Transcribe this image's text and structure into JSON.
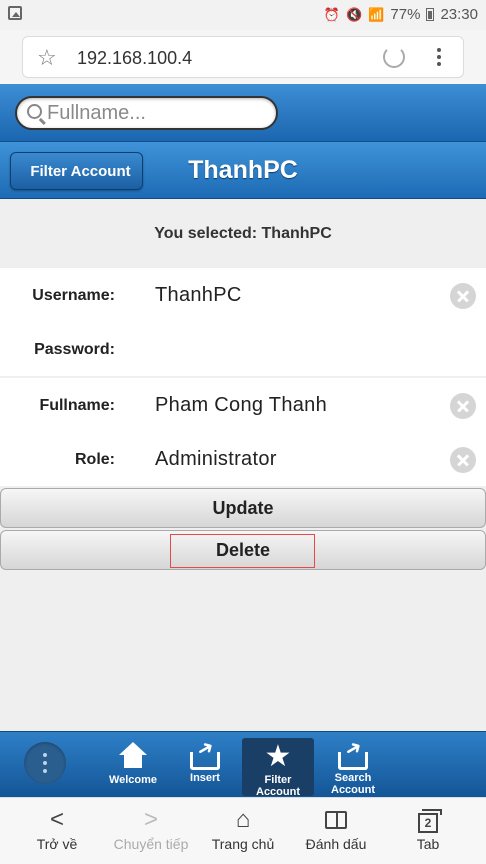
{
  "status_bar": {
    "battery": "77%",
    "time": "23:30"
  },
  "browser": {
    "url": "192.168.100.4"
  },
  "search": {
    "placeholder": "Fullname..."
  },
  "header": {
    "back_label": "Filter Account",
    "title": "ThanhPC"
  },
  "selection": {
    "text": "You selected: ThanhPC"
  },
  "form": {
    "username": {
      "label": "Username:",
      "value": "ThanhPC"
    },
    "password": {
      "label": "Password:",
      "value": ""
    },
    "fullname": {
      "label": "Fullname:",
      "value": "Pham Cong Thanh"
    },
    "role": {
      "label": "Role:",
      "value": "Administrator"
    }
  },
  "actions": {
    "update_label": "Update",
    "delete_label": "Delete"
  },
  "navbar": {
    "items": [
      {
        "label": "Welcome",
        "icon": "home-icon"
      },
      {
        "label": "Insert",
        "icon": "share-icon"
      },
      {
        "label": "Filter Account",
        "icon": "star-icon",
        "active": true
      },
      {
        "label": "Search Account",
        "icon": "share-icon"
      }
    ]
  },
  "browser_bar": {
    "back": "Trở về",
    "forward": "Chuyển tiếp",
    "home": "Trang chủ",
    "bookmarks": "Đánh dấu",
    "tabs": "Tab",
    "tab_count": "2"
  },
  "colors": {
    "header_blue": "#1d6bb5",
    "navbar_blue": "#145697",
    "highlight_red": "#e34a4a"
  }
}
